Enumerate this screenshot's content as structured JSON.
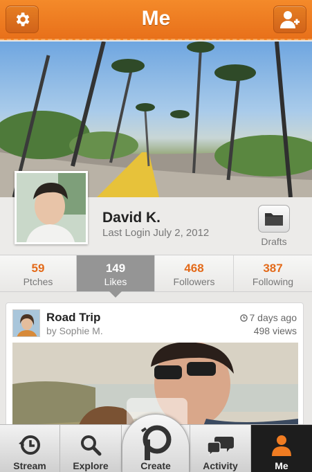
{
  "header": {
    "title": "Me",
    "settings_icon": "gear-icon",
    "add_friend_icon": "add-user-icon"
  },
  "profile": {
    "name": "David K.",
    "last_login": "Last Login July 2, 2012",
    "drafts_label": "Drafts"
  },
  "stats": [
    {
      "count": "59",
      "label": "Ptches",
      "active": false
    },
    {
      "count": "149",
      "label": "Likes",
      "active": true
    },
    {
      "count": "468",
      "label": "Followers",
      "active": false
    },
    {
      "count": "387",
      "label": "Following",
      "active": false
    }
  ],
  "feed": {
    "title": "Road Trip",
    "author": "by Sophie M.",
    "time": "7 days ago",
    "views": "498 views"
  },
  "tabbar": [
    {
      "label": "Stream",
      "icon": "history-clock-icon"
    },
    {
      "label": "Explore",
      "icon": "search-icon"
    },
    {
      "label": "Create",
      "icon": "create-p-icon"
    },
    {
      "label": "Activity",
      "icon": "chat-bubbles-icon"
    },
    {
      "label": "Me",
      "icon": "user-icon",
      "active": true
    }
  ],
  "colors": {
    "accent": "#e8701a",
    "tab_active_bg": "#1d1d1d",
    "stat_active_bg": "#959595"
  }
}
